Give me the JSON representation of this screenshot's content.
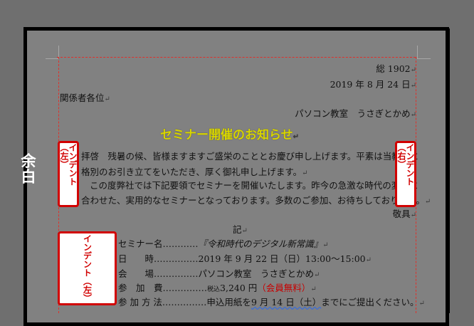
{
  "margin_label": "余白",
  "doc": {
    "number": "総 1902",
    "date": "2019 年 8 月 24 日",
    "recipient": "関係者各位",
    "sender": "パソコン教室　うさぎとかめ",
    "title": "セミナー開催のお知らせ",
    "para1_line1": "拝啓　残暑の候、皆様ますますご盛栄のこととお慶び申し上げます。平素は当教室に",
    "para1_line2": "格別のお引き立てをいただき、厚く御礼申し上げます。",
    "para2_line1": "この度弊社では下記要領でセミナーを開催いたします。昨今の急激な時代の変化に",
    "para2_line2": "合わせた、実用的なセミナーとなっております。多数のご参加、お待ちしております。",
    "closing": "敬具",
    "ki": "記",
    "items": [
      {
        "label": "セミナー名",
        "dots": "…………",
        "value": "『令和時代のデジタル新常識』"
      },
      {
        "label": "日　　時",
        "dots": "……………",
        "value": "2019 年 9 月 22 日（日）13:00～15:00"
      },
      {
        "label": "会　　場",
        "dots": "……………",
        "value": "パソコン教室　うさぎとかめ"
      },
      {
        "label": "参　加　費",
        "dots": "……………",
        "prefix": "税込",
        "value": "3,240 円",
        "extra": "（会員無料）"
      },
      {
        "label": "参 加 方 法",
        "dots": "……………",
        "value_pre": "申込用紙を",
        "value_ul": "9 月 14 日（土）",
        "value_post": "までにご提出ください。"
      }
    ]
  },
  "annotations": {
    "indent_left_1": "インデント（左）",
    "indent_right": "インデント（右）",
    "indent_left_2": "インデント（左）"
  },
  "mark": "↵"
}
